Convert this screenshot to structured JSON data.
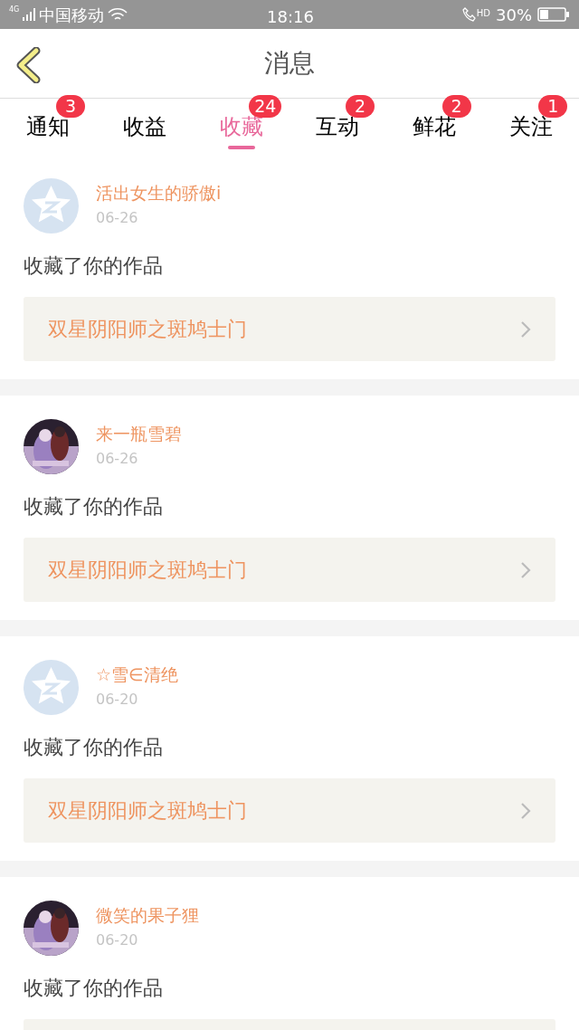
{
  "status_bar": {
    "network": "4G",
    "carrier": "中国移动",
    "time": "18:16",
    "call": "HD",
    "battery": "30%"
  },
  "header": {
    "title": "消息"
  },
  "tabs": [
    {
      "label": "通知",
      "badge": "3",
      "selected": false
    },
    {
      "label": "收益",
      "selected": false
    },
    {
      "label": "收藏",
      "badge": "24",
      "selected": true
    },
    {
      "label": "互动",
      "badge": "2",
      "selected": false
    },
    {
      "label": "鲜花",
      "badge": "2",
      "selected": false
    },
    {
      "label": "关注",
      "badge": "1",
      "selected": false
    }
  ],
  "messages": [
    {
      "avatar": {
        "kind": "default"
      },
      "user": "活出女生的骄傲i",
      "date": "06-26",
      "action": "收藏了你的作品",
      "work": "双星阴阳师之斑鸠士门"
    },
    {
      "user": "来一瓶雪碧",
      "date": "06-26",
      "action": "收藏了你的作品",
      "work": "双星阴阳师之斑鸠士门"
    },
    {
      "avatar": {
        "kind": "default"
      },
      "user": "☆雪∈清绝",
      "date": "06-20",
      "action": "收藏了你的作品",
      "work": "双星阴阳师之斑鸠士门"
    },
    {
      "user": "微笑的果子狸",
      "date": "06-20",
      "action": "收藏了你的作品"
    }
  ]
}
